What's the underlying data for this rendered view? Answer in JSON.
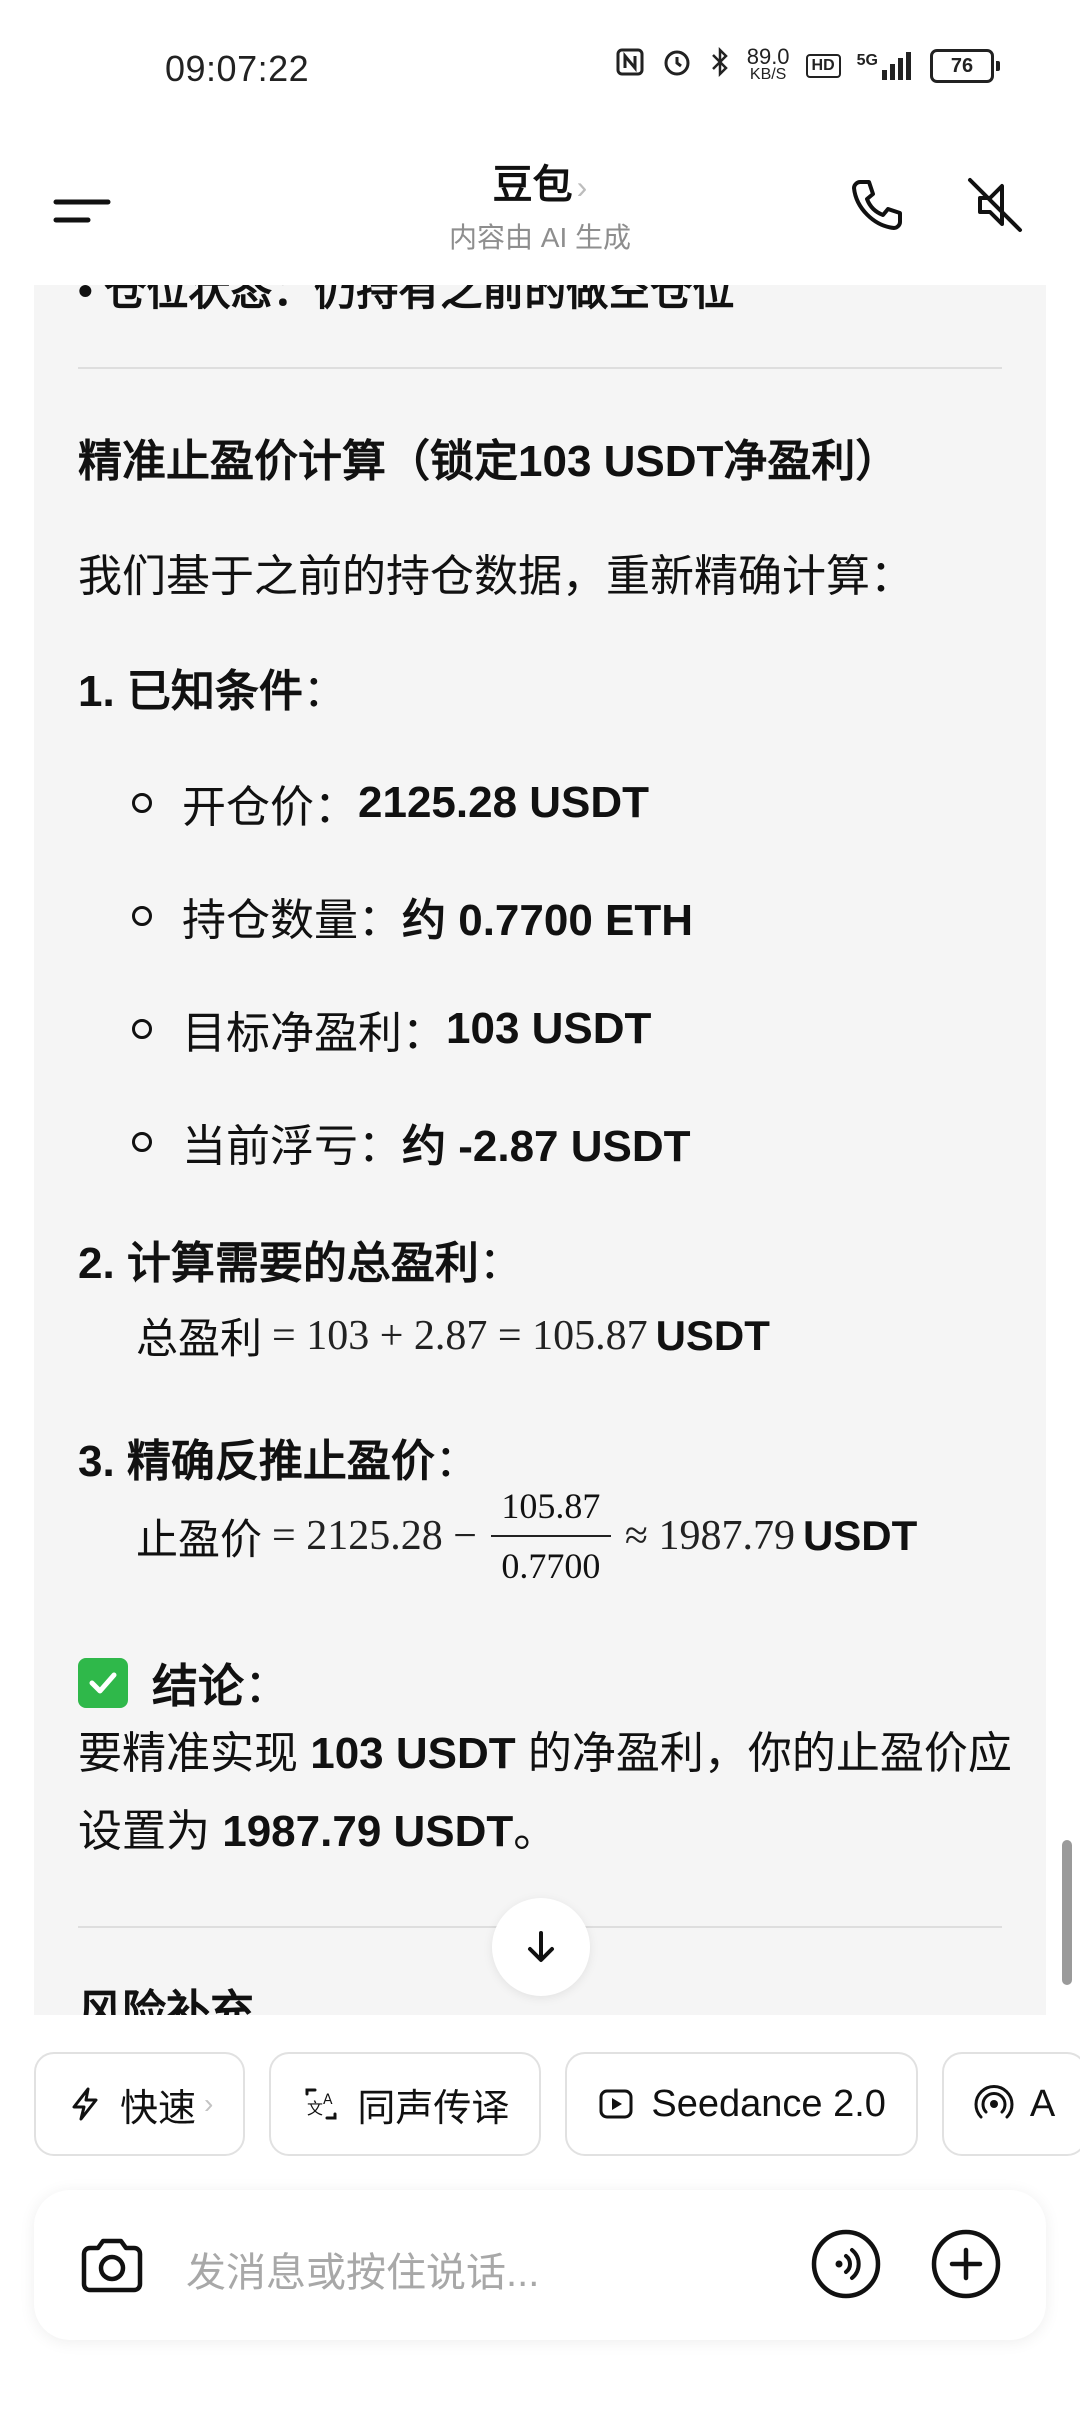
{
  "status_bar": {
    "time": "09:07:22",
    "net_speed_value": "89.0",
    "net_speed_unit": "KB/S",
    "hd_badge": "HD",
    "signal_label": "5G",
    "battery": "76"
  },
  "header": {
    "title": "豆包",
    "title_chevron": "›",
    "subtitle": "内容由 AI 生成"
  },
  "chat": {
    "cut_top_line": "• 仓位状态：仍持有之前的做空仓位",
    "section_title": "精准止盈价计算（锁定103 USDT净盈利）",
    "intro": "我们基于之前的持仓数据，重新精确计算：",
    "step1": {
      "label": "1. 已知条件",
      "colon": "：",
      "items": [
        {
          "label": "开仓价：",
          "value": "2125.28 USDT"
        },
        {
          "label": "持仓数量：",
          "value": "约 0.7700 ETH"
        },
        {
          "label": "目标净盈利：",
          "value": "103 USDT"
        },
        {
          "label": "当前浮亏：",
          "value": "约 -2.87 USDT"
        }
      ]
    },
    "step2": {
      "label": "2. 计算需要的总盈利",
      "colon": "：",
      "formula_prefix": "总盈利",
      "formula_math": "= 103 + 2.87 = 105.87",
      "formula_unit": "USDT"
    },
    "step3": {
      "label": "3. 精确反推止盈价",
      "colon": "：",
      "formula_prefix": "止盈价",
      "formula_math_left": "= 2125.28 −",
      "numerator": "105.87",
      "denominator": "0.7700",
      "formula_math_right": "≈ 1987.79",
      "formula_unit": "USDT"
    },
    "conclusion": {
      "heading": "结论",
      "colon": "：",
      "text_1": "要精准实现 ",
      "bold_1": "103 USDT",
      "text_2": " 的净盈利，你的止盈价应设置为 ",
      "bold_2": "1987.79 USDT",
      "text_3": "。"
    },
    "cut_bottom_heading": "风险补充"
  },
  "chips": [
    {
      "label": "快速",
      "icon": "lightning-icon",
      "has_chevron": true
    },
    {
      "label": "同声传译",
      "icon": "translate-icon"
    },
    {
      "label": "Seedance 2.0",
      "icon": "video-play-icon"
    },
    {
      "label": "A",
      "icon": "broadcast-icon"
    }
  ],
  "input": {
    "placeholder": "发消息或按住说话..."
  }
}
